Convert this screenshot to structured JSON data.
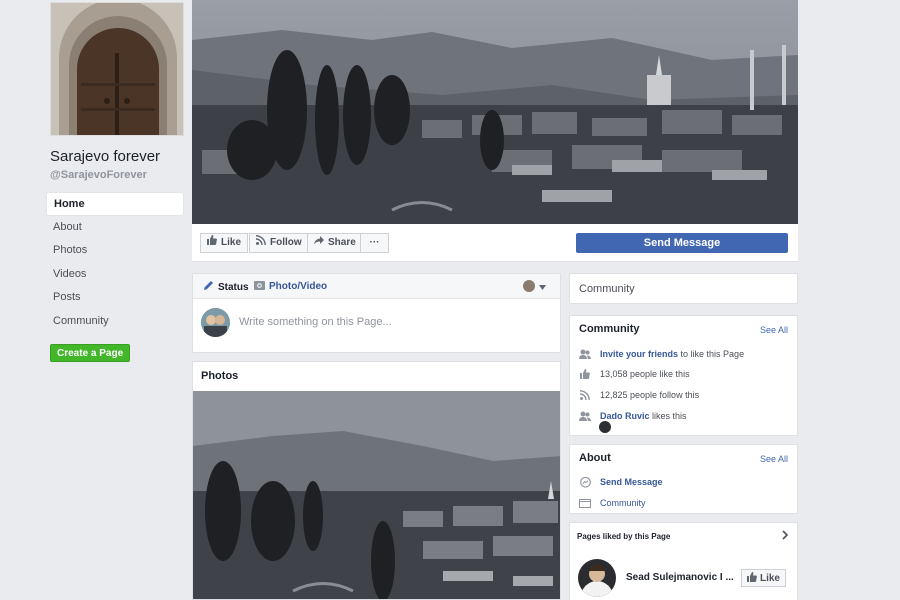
{
  "page": {
    "name": "Sarajevo forever",
    "handle": "@SarajevoForever"
  },
  "nav": {
    "items": [
      {
        "label": "Home"
      },
      {
        "label": "About"
      },
      {
        "label": "Photos"
      },
      {
        "label": "Videos"
      },
      {
        "label": "Posts"
      },
      {
        "label": "Community"
      }
    ],
    "create_page": "Create a Page"
  },
  "actions": {
    "like": "Like",
    "follow": "Follow",
    "share": "Share",
    "more": "···",
    "send_message": "Send Message"
  },
  "composer": {
    "status_tab": "Status",
    "photo_tab": "Photo/Video",
    "placeholder": "Write something on this Page..."
  },
  "photos": {
    "title": "Photos"
  },
  "community_top": {
    "label": "Community"
  },
  "community": {
    "title": "Community",
    "see_all": "See All",
    "invite_link": "Invite your friends",
    "invite_rest": " to like this Page",
    "likes": "13,058 people like this",
    "follows": "12,825 people follow this",
    "friend_name": "Dado Ruvic",
    "friend_rest": " likes this"
  },
  "about": {
    "title": "About",
    "see_all": "See All",
    "send_message": "Send Message",
    "category": "Community"
  },
  "pages_liked": {
    "title": "Pages liked by this Page",
    "page_name": "Sead Sulejmanovic I ...",
    "like_label": "Like"
  },
  "colors": {
    "accent": "#4267b2",
    "link": "#365899",
    "create_green": "#42b72a",
    "background": "#e9ebee"
  }
}
